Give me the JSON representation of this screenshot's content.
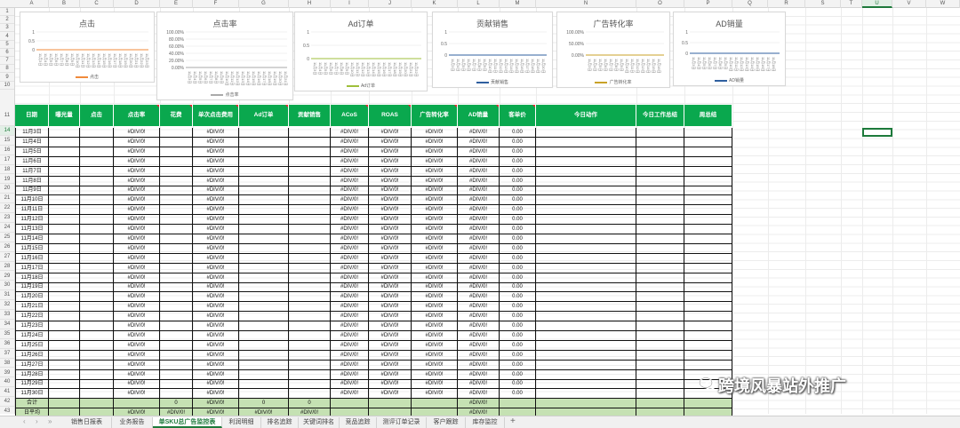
{
  "columns": [
    "A",
    "B",
    "C",
    "D",
    "E",
    "F",
    "G",
    "H",
    "I",
    "J",
    "K",
    "L",
    "M",
    "N",
    "O",
    "P",
    "Q",
    "R",
    "S",
    "T",
    "U",
    "V",
    "W"
  ],
  "selected_column": "U",
  "rows_top": [
    "1",
    "2",
    "3",
    "4",
    "5",
    "6",
    "7",
    "8",
    "9",
    "10",
    "11"
  ],
  "rows_data": [
    "14",
    "15",
    "16",
    "17",
    "18",
    "19",
    "20",
    "21",
    "22",
    "23",
    "24",
    "25",
    "26",
    "27",
    "28",
    "29",
    "30",
    "31",
    "32",
    "33",
    "34",
    "35",
    "36",
    "37",
    "38",
    "39",
    "40",
    "41",
    "42",
    "43"
  ],
  "selected_row": "14",
  "charts": [
    {
      "title": "点击",
      "yticks": [
        "1",
        "0.5",
        "0"
      ],
      "legend": "点击",
      "color": "#f08a3a"
    },
    {
      "title": "点击率",
      "yticks": [
        "100.00%",
        "80.00%",
        "60.00%",
        "40.00%",
        "20.00%",
        "0.00%"
      ],
      "legend": "点击率",
      "color": "#aaaaaa"
    },
    {
      "title": "Ad订单",
      "yticks": [
        "1",
        "0.5",
        "0"
      ],
      "legend": "Ad订单",
      "color": "#9fbf3b"
    },
    {
      "title": "贡献销售",
      "yticks": [
        "1",
        "0.5",
        "0"
      ],
      "legend": "贡献销售",
      "color": "#2f5f9f"
    },
    {
      "title": "广告转化率",
      "yticks": [
        "100.00%",
        "50.00%",
        "0.00%"
      ],
      "legend": "广告转化率",
      "color": "#c9a227"
    },
    {
      "title": "AD销量",
      "yticks": [
        "1",
        "0.5",
        "0"
      ],
      "legend": "AD销量",
      "color": "#2f5f9f"
    }
  ],
  "table": {
    "headers": [
      "日期",
      "曝光量",
      "点击",
      "点击率",
      "花费",
      "单次点击费用",
      "Ad订单",
      "贡献销售",
      "ACoS",
      "ROAS",
      "广告转化率",
      "AD销量",
      "客单价",
      "今日动作",
      "今日工作总结",
      "周总结"
    ],
    "dates": [
      "11月3日",
      "11月4日",
      "11月5日",
      "11月6日",
      "11月7日",
      "11月8日",
      "11月9日",
      "11月10日",
      "11月11日",
      "11月12日",
      "11月13日",
      "11月14日",
      "11月15日",
      "11月16日",
      "11月17日",
      "11月18日",
      "11月19日",
      "11月20日",
      "11月21日",
      "11月22日",
      "11月23日",
      "11月24日",
      "11月25日",
      "11月26日",
      "11月27日",
      "11月28日",
      "11月29日",
      "11月30日"
    ],
    "div_error": "#DIV/0!",
    "zero_value": "0.00",
    "sum_row": {
      "label": "合计",
      "huafei": "0",
      "danci": "#DIV/0!",
      "ad": "0",
      "gongxian": "0",
      "adxl": "#DIV/0!"
    },
    "avg_row": {
      "label": "日平均",
      "dianjilv": "#DIV/0!",
      "huafei": "#DIV/0!",
      "danci": "#DIV/0!",
      "ad": "#DIV/0!",
      "gongxian": "#DIV/0!",
      "adxl": "#DIV/0!"
    }
  },
  "sheet_tabs": [
    "销售日报表",
    "业务报告",
    "单SKU总广告监控表",
    "利润明细",
    "排名追踪",
    "关键词排名",
    "竞品追踪",
    "测评订单记录",
    "客户跟踪",
    "库存监控"
  ],
  "active_tab": "单SKU总广告监控表",
  "add_tab": "+",
  "nav_arrows": [
    "‹",
    "›",
    "»"
  ],
  "watermark": "跨境风暴站外推广"
}
